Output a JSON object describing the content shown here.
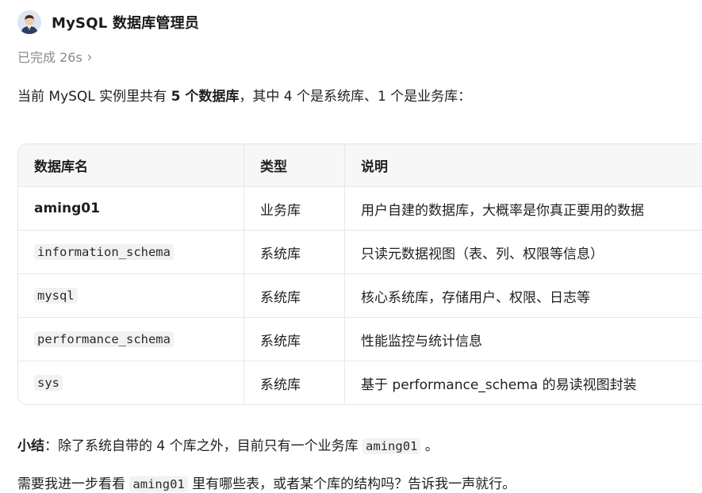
{
  "agent": {
    "name": "MySQL 数据库管理员",
    "avatar_icon": "agent-avatar-icon"
  },
  "status": {
    "label": "已完成 26s",
    "chevron": "›"
  },
  "intro": {
    "prefix": "当前 MySQL 实例里共有 ",
    "highlight": "5 个数据库",
    "suffix": "，其中 4 个是系统库、1 个是业务库："
  },
  "table": {
    "headers": [
      "数据库名",
      "类型",
      "说明"
    ],
    "rows": [
      {
        "name": "aming01",
        "name_style": "bold",
        "type": "业务库",
        "desc": "用户自建的数据库，大概率是你真正要用的数据"
      },
      {
        "name": "information_schema",
        "name_style": "code",
        "type": "系统库",
        "desc": "只读元数据视图（表、列、权限等信息）"
      },
      {
        "name": "mysql",
        "name_style": "code",
        "type": "系统库",
        "desc": "核心系统库，存储用户、权限、日志等"
      },
      {
        "name": "performance_schema",
        "name_style": "code",
        "type": "系统库",
        "desc": "性能监控与统计信息"
      },
      {
        "name": "sys",
        "name_style": "code",
        "type": "系统库",
        "desc": "基于 performance_schema 的易读视图封装"
      }
    ]
  },
  "summary": {
    "label": "小结",
    "text_before": "：除了系统自带的 4 个库之外，目前只有一个业务库 ",
    "code": "aming01",
    "text_after": " 。"
  },
  "followup": {
    "text_before": "需要我进一步看看 ",
    "code": "aming01",
    "text_after": " 里有哪些表，或者某个库的结构吗？告诉我一声就行。"
  }
}
